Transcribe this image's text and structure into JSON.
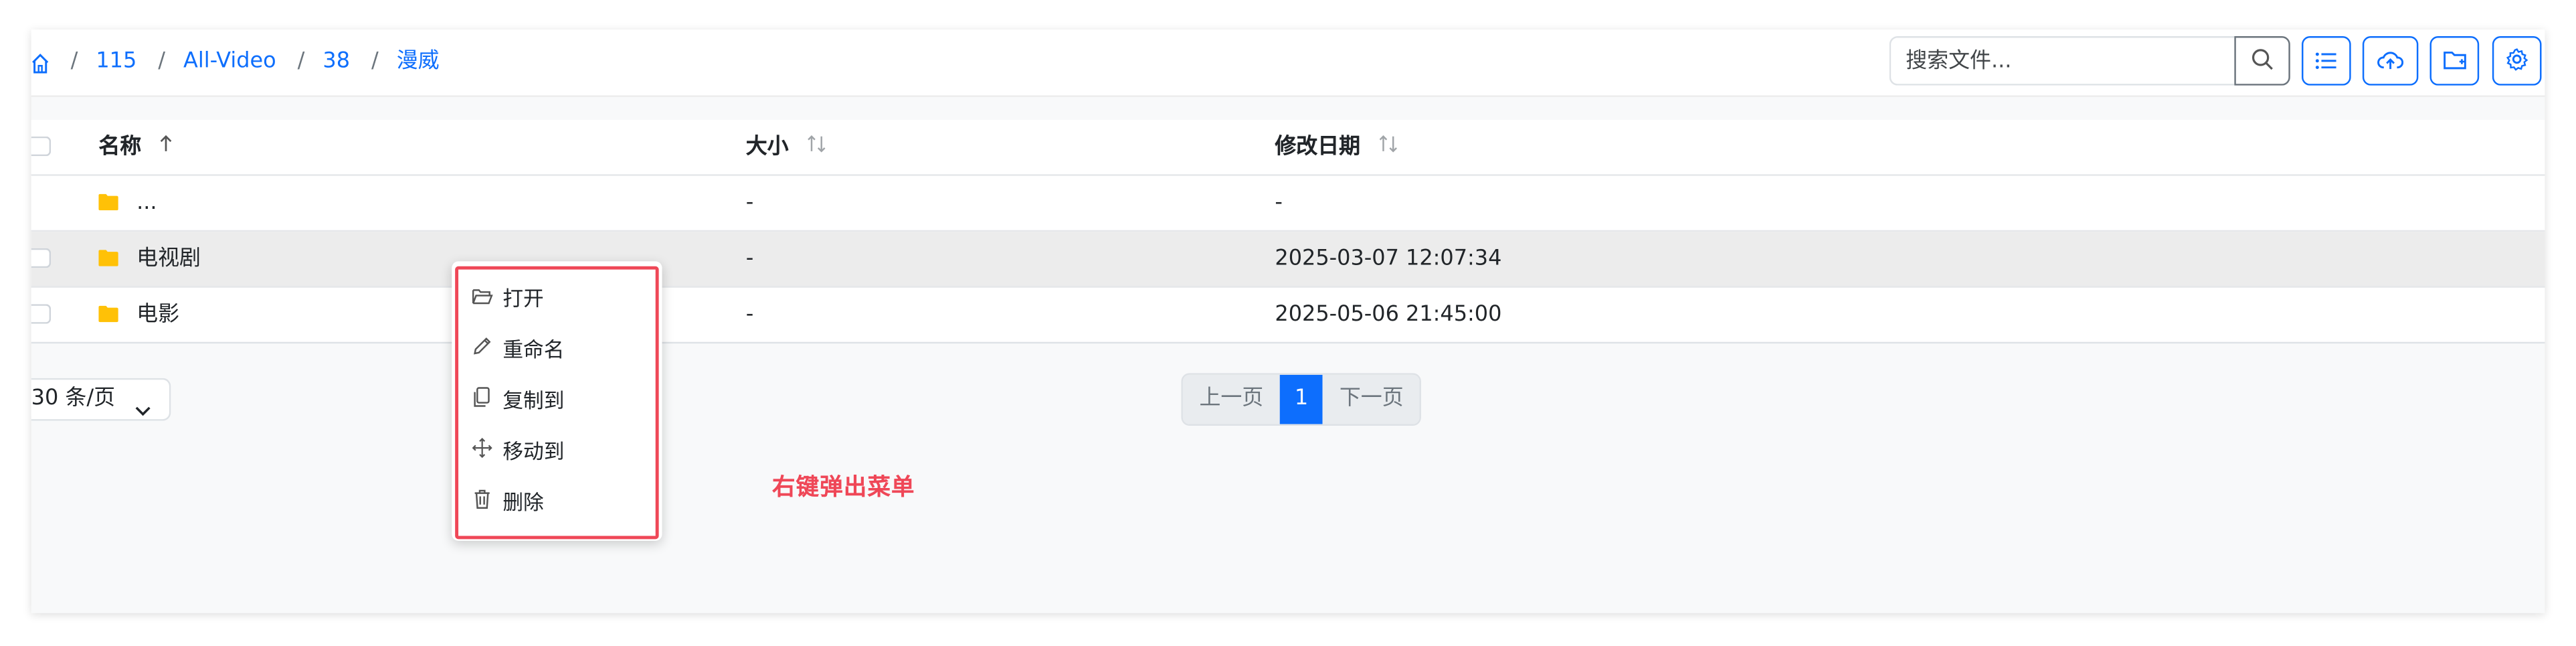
{
  "breadcrumb": {
    "home_icon": "home-icon",
    "items": [
      "115",
      "All-Video",
      "38",
      "漫威"
    ],
    "separator": "/"
  },
  "toolbar": {
    "search_placeholder": "搜索文件...",
    "search_icon": "search-icon",
    "buttons": [
      "list-view-icon",
      "upload-cloud-icon",
      "new-folder-icon",
      "settings-icon"
    ],
    "accent_color": "#0d6efd"
  },
  "table": {
    "columns": {
      "name": "名称",
      "size": "大小",
      "modified": "修改日期"
    },
    "rows": [
      {
        "name": "...",
        "size": "-",
        "modified": "-"
      },
      {
        "name": "电视剧",
        "size": "-",
        "modified": "2025-03-07 12:07:34"
      },
      {
        "name": "电影",
        "size": "-",
        "modified": "2025-05-06 21:45:00"
      }
    ]
  },
  "pagination": {
    "page_size_label": "30 条/页",
    "prev_label": "上一页",
    "current_page": "1",
    "next_label": "下一页"
  },
  "context_menu": {
    "items": [
      {
        "label": "打开",
        "icon": "folder-open-icon"
      },
      {
        "label": "重命名",
        "icon": "pencil-icon"
      },
      {
        "label": "复制到",
        "icon": "copy-icon"
      },
      {
        "label": "移动到",
        "icon": "move-icon"
      },
      {
        "label": "删除",
        "icon": "trash-icon"
      }
    ],
    "highlight_color": "#ef4757"
  },
  "annotation": "右键弹出菜单"
}
